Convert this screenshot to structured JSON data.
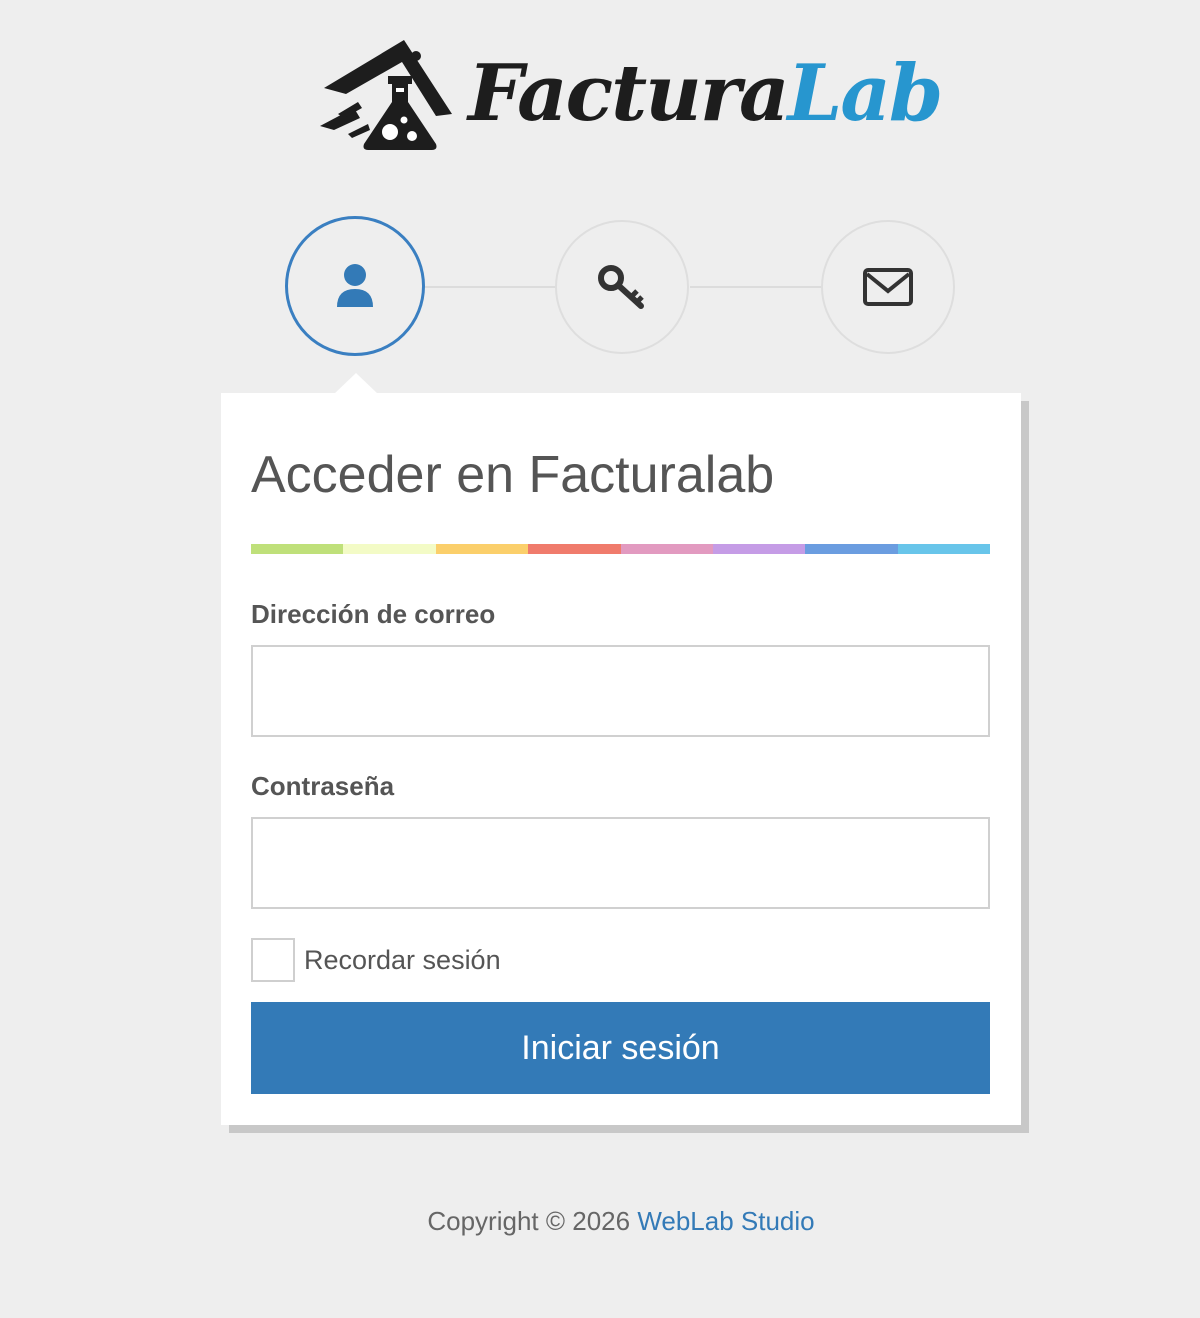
{
  "logo": {
    "text_primary": "Factura",
    "text_accent": "Lab",
    "icon": "flask-icon"
  },
  "steps": [
    {
      "icon": "user-icon",
      "active": true
    },
    {
      "icon": "key-icon",
      "active": false
    },
    {
      "icon": "envelope-icon",
      "active": false
    }
  ],
  "login": {
    "title": "Acceder en Facturalab",
    "email_label": "Dirección de correo",
    "email_value": "",
    "password_label": "Contraseña",
    "password_value": "",
    "remember_label": "Recordar sesión",
    "remember_checked": false,
    "submit_label": "Iniciar sesión"
  },
  "rainbow_colors": [
    "#bfe07a",
    "#f3fbc6",
    "#fbcf6b",
    "#f07b6c",
    "#e29ac0",
    "#c59ce6",
    "#6b9de0",
    "#68c5ea"
  ],
  "footer": {
    "copyright": "Copyright © 2026",
    "link_text": "WebLab Studio"
  },
  "colors": {
    "primary": "#337ab7",
    "logo_accent": "#2796cf",
    "background": "#eeeeee"
  }
}
